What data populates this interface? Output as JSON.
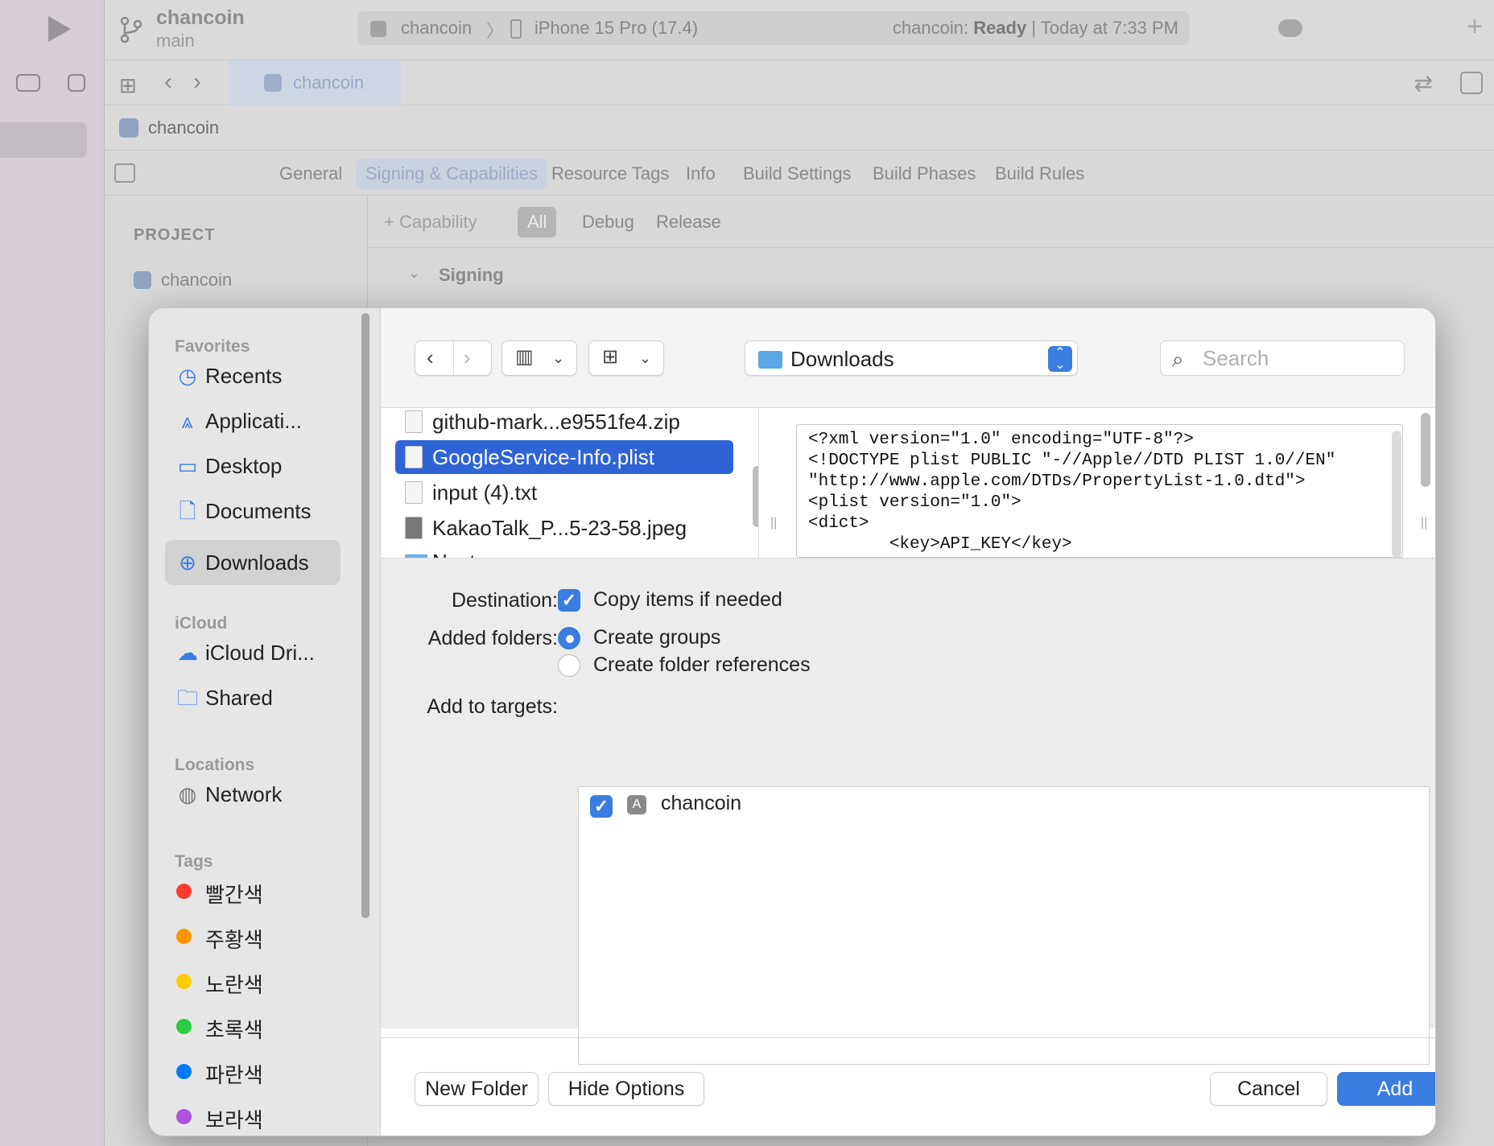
{
  "xcode": {
    "project_name": "chancoin",
    "branch": "main",
    "scheme": "chancoin",
    "device": "iPhone 15 Pro (17.4)",
    "status_prefix": "chancoin: ",
    "status_bold": "Ready",
    "status_suffix": " | Today at 7:33 PM",
    "tab_title": "chancoin",
    "breadcrumb": "chancoin",
    "editor_tabs": [
      "General",
      "Signing & Capabilities",
      "Resource Tags",
      "Info",
      "Build Settings",
      "Build Phases",
      "Build Rules"
    ],
    "project_header": "PROJECT",
    "project_item": "chancoin",
    "capability_label": "+ Capability",
    "config_tabs": [
      "All",
      "Debug",
      "Release"
    ],
    "signing_section": "Signing"
  },
  "dialog": {
    "sidebar": {
      "favorites_header": "Favorites",
      "favorites": [
        {
          "label": "Recents",
          "icon": "clock-icon"
        },
        {
          "label": "Applicati...",
          "icon": "applications-icon"
        },
        {
          "label": "Desktop",
          "icon": "desktop-icon"
        },
        {
          "label": "Documents",
          "icon": "document-icon"
        },
        {
          "label": "Downloads",
          "icon": "download-icon",
          "selected": true
        }
      ],
      "icloud_header": "iCloud",
      "icloud": [
        {
          "label": "iCloud Dri...",
          "icon": "cloud-icon"
        },
        {
          "label": "Shared",
          "icon": "shared-folder-icon"
        }
      ],
      "locations_header": "Locations",
      "locations": [
        {
          "label": "Network",
          "icon": "globe-icon"
        }
      ],
      "tags_header": "Tags",
      "tags": [
        {
          "label": "빨간색",
          "color": "#ff3b30"
        },
        {
          "label": "주황색",
          "color": "#ff9500"
        },
        {
          "label": "노란색",
          "color": "#ffcc00"
        },
        {
          "label": "초록색",
          "color": "#28cd41"
        },
        {
          "label": "파란색",
          "color": "#007aff"
        },
        {
          "label": "보라색",
          "color": "#af52de"
        }
      ]
    },
    "toolbar": {
      "location": "Downloads",
      "search_placeholder": "Search"
    },
    "files": [
      {
        "name": "github-mark...e9551fe4.zip"
      },
      {
        "name": "GoogleService-Info.plist",
        "selected": true
      },
      {
        "name": "input (4).txt"
      },
      {
        "name": "KakaoTalk_P...5-23-58.jpeg"
      },
      {
        "name": "Next",
        "folder": true
      }
    ],
    "preview_text": "<?xml version=\"1.0\" encoding=\"UTF-8\"?>\n<!DOCTYPE plist PUBLIC \"-//Apple//DTD PLIST 1.0//EN\"\n\"http://www.apple.com/DTDs/PropertyList-1.0.dtd\">\n<plist version=\"1.0\">\n<dict>\n        <key>API_KEY</key>",
    "options": {
      "destination_label": "Destination:",
      "copy_items": "Copy items if needed",
      "added_folders_label": "Added folders:",
      "create_groups": "Create groups",
      "create_folder_refs": "Create folder references",
      "add_to_targets_label": "Add to targets:",
      "target_name": "chancoin"
    },
    "buttons": {
      "new_folder": "New Folder",
      "hide_options": "Hide Options",
      "cancel": "Cancel",
      "add": "Add"
    },
    "accent_color": "#3a7de0"
  }
}
